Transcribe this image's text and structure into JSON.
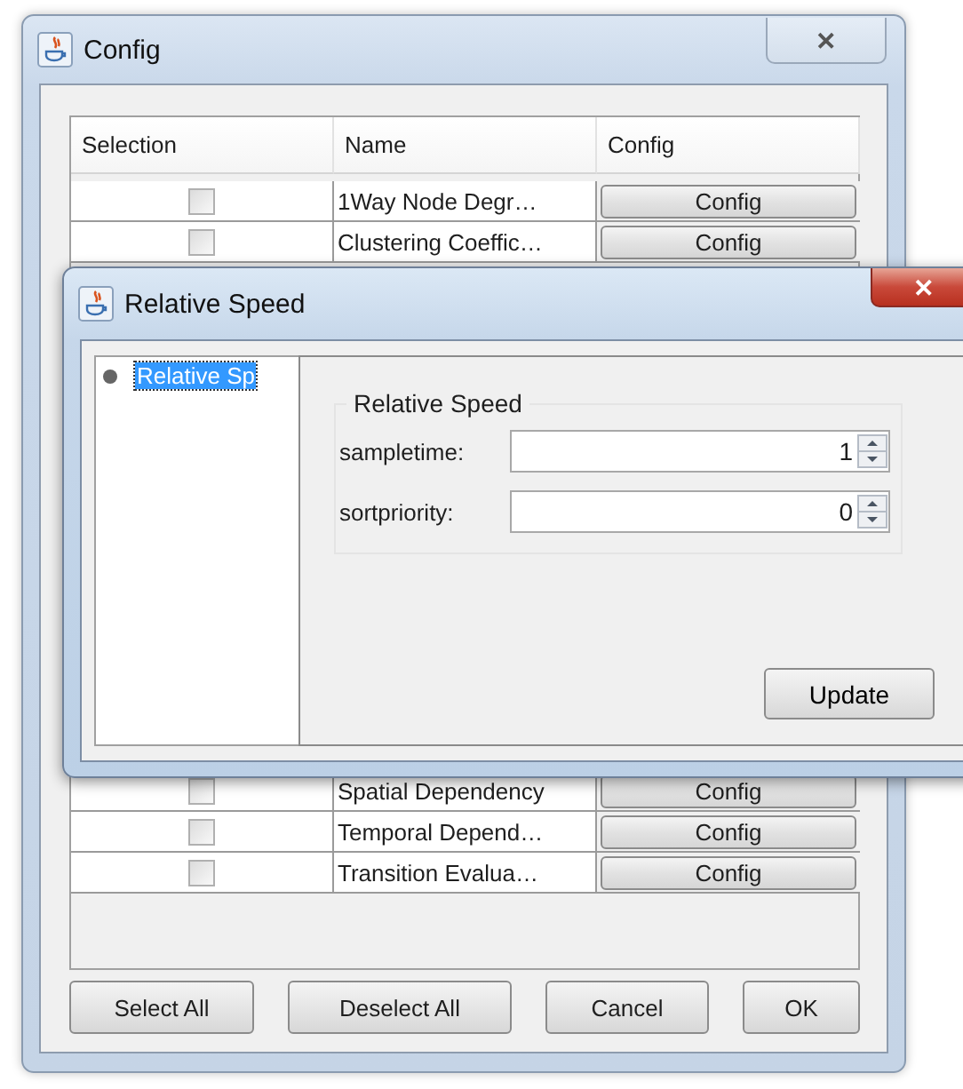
{
  "window": {
    "title": "Config",
    "close": "✕"
  },
  "table": {
    "columns": [
      "Selection",
      "Name",
      "Config"
    ],
    "rows_top": [
      {
        "checked": false,
        "name": "1Way Node Degr…",
        "action": "Config"
      },
      {
        "checked": false,
        "name": "Clustering Coeffic…",
        "action": "Config"
      }
    ],
    "rows_bottom": [
      {
        "checked": false,
        "name": "Spatial Dependency",
        "action": "Config"
      },
      {
        "checked": false,
        "name": "Temporal Depend…",
        "action": "Config"
      },
      {
        "checked": false,
        "name": "Transition Evalua…",
        "action": "Config"
      }
    ]
  },
  "buttons": [
    "Select All",
    "Deselect All",
    "Cancel",
    "OK"
  ],
  "dialog": {
    "title": "Relative Speed",
    "close": "✕",
    "tree": [
      {
        "label": "Relative Sp",
        "selected": true
      }
    ],
    "group": {
      "title": "Relative Speed",
      "fields": [
        {
          "label": "sampletime:",
          "value": "1"
        },
        {
          "label": "sortpriority:",
          "value": "0"
        }
      ]
    },
    "update": "Update"
  }
}
